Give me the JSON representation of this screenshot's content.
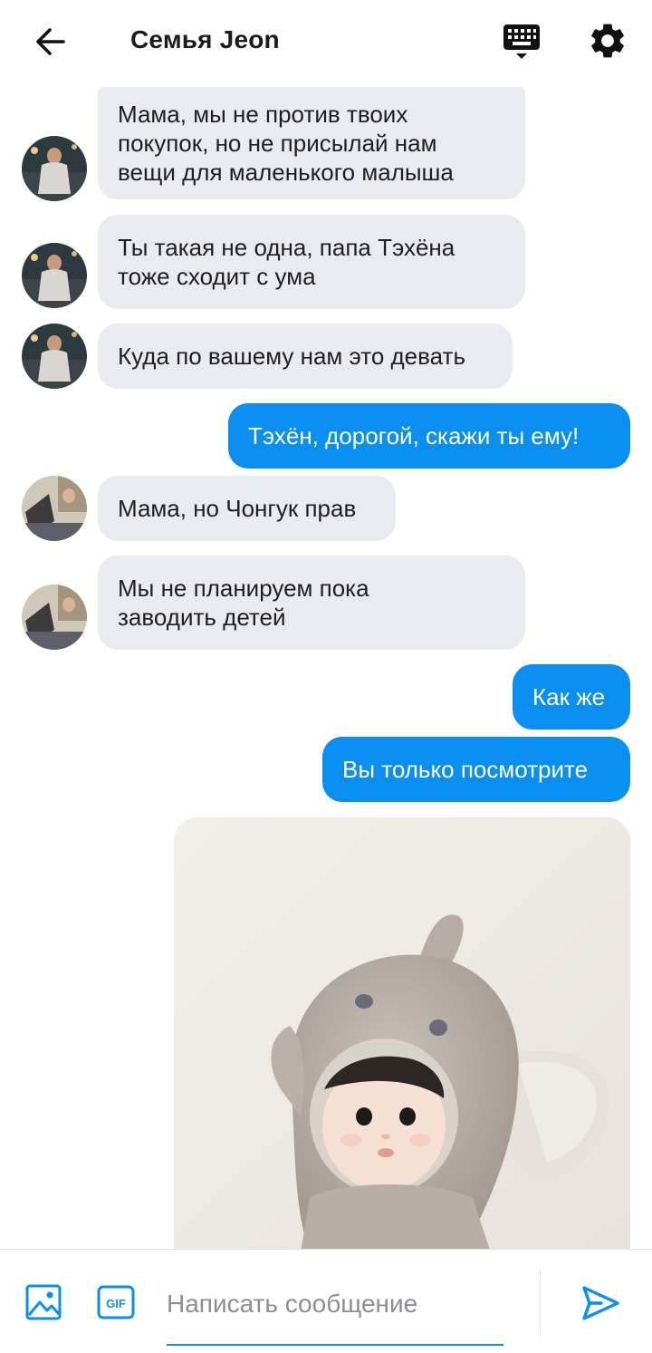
{
  "header": {
    "title": "Семья Jeon"
  },
  "messages": [
    {
      "side": "in",
      "text": "Мама, мы не против твоих\nпокупок, но не присылай нам\nвещи для маленького малыша"
    },
    {
      "side": "in",
      "text": "Ты такая не одна, папа Тэхёна\nтоже сходит с ума"
    },
    {
      "side": "in",
      "text": "Куда по вашему нам это девать"
    },
    {
      "side": "out",
      "text": "Тэхён, дорогой, скажи ты ему!"
    },
    {
      "side": "in",
      "text": "Мама, но Чонгук прав"
    },
    {
      "side": "in",
      "text": "Мы не планируем пока\nзаводить детей"
    },
    {
      "side": "out",
      "text": "Как же"
    },
    {
      "side": "out",
      "text": "Вы только посмотрите"
    }
  ],
  "composer": {
    "placeholder": "Написать сообщение",
    "gif_label": "GIF"
  },
  "colors": {
    "accent": "#0a8ff0",
    "incoming_bubble": "#eaebf0"
  },
  "icons": {
    "back": "arrow-left-icon",
    "keyboard": "keyboard-icon",
    "settings": "gear-icon",
    "image": "image-icon",
    "gif": "gif-icon",
    "send": "send-icon"
  }
}
